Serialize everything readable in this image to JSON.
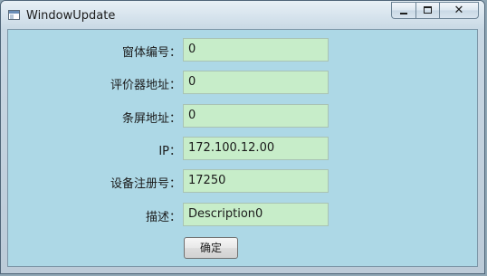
{
  "window": {
    "title": "WindowUpdate",
    "controls": {
      "minimize": "minimize",
      "maximize": "maximize",
      "close": "✕"
    }
  },
  "form": {
    "fields": [
      {
        "label": "窗体编号：",
        "value": "0"
      },
      {
        "label": "评价器地址：",
        "value": "0"
      },
      {
        "label": "条屏地址：",
        "value": "0"
      },
      {
        "label": "IP：",
        "value": "172.100.12.00"
      },
      {
        "label": "设备注册号：",
        "value": "17250"
      },
      {
        "label": "描述：",
        "value": "Description0"
      }
    ],
    "ok_label": "确定"
  },
  "colors": {
    "client_background": "#add8e6",
    "field_background": "#c7edc9",
    "title_text": "#1b1b1b"
  },
  "icons": {
    "app": "window-app-icon",
    "minimize": "minimize-icon",
    "maximize": "maximize-icon",
    "close": "close-icon"
  }
}
